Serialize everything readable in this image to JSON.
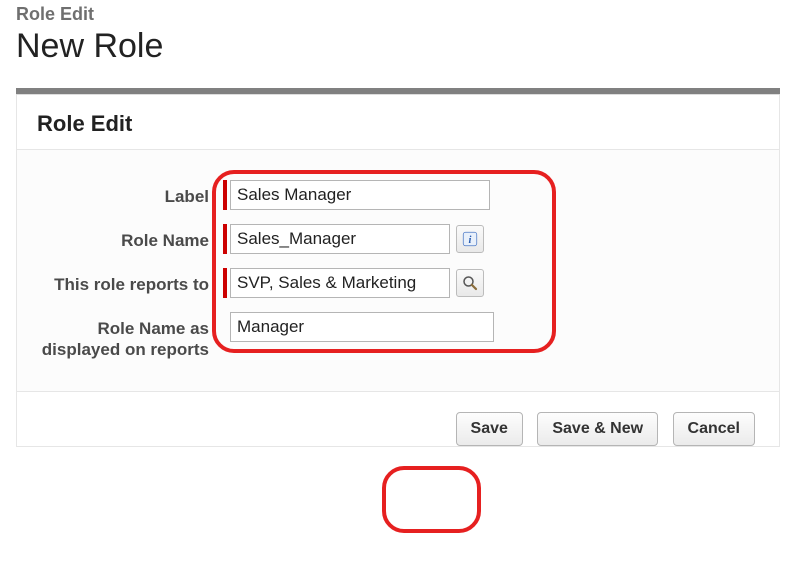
{
  "header": {
    "crumb": "Role Edit",
    "title": "New Role"
  },
  "section": {
    "title": "Role Edit"
  },
  "fields": {
    "label": {
      "label": "Label",
      "value": "Sales Manager"
    },
    "role_name": {
      "label": "Role Name",
      "value": "Sales_Manager"
    },
    "reports_to": {
      "label": "This role reports to",
      "value": "SVP, Sales & Marketing"
    },
    "display_name": {
      "label": "Role Name as displayed on reports",
      "value": "Manager"
    }
  },
  "buttons": {
    "save": "Save",
    "save_new": "Save & New",
    "cancel": "Cancel"
  },
  "colors": {
    "required": "#c00",
    "highlight": "#e62020"
  }
}
